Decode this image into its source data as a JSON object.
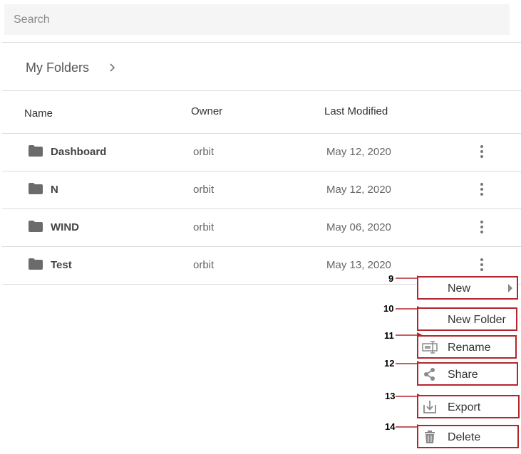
{
  "search": {
    "placeholder": "Search",
    "value": ""
  },
  "breadcrumb": {
    "label": "My Folders"
  },
  "table": {
    "headers": {
      "name": "Name",
      "owner": "Owner",
      "modified": "Last Modified"
    },
    "rows": [
      {
        "name": "Dashboard",
        "owner": "orbit",
        "modified": "May 12, 2020"
      },
      {
        "name": "N",
        "owner": "orbit",
        "modified": "May 12, 2020"
      },
      {
        "name": "WIND",
        "owner": "orbit",
        "modified": "May 06, 2020"
      },
      {
        "name": "Test",
        "owner": "orbit",
        "modified": "May 13, 2020"
      }
    ]
  },
  "context_menu": {
    "items": [
      {
        "label": "New",
        "callout": "9",
        "icon": "",
        "submenu": true
      },
      {
        "label": "New Folder",
        "callout": "10",
        "icon": ""
      },
      {
        "label": "Rename",
        "callout": "11",
        "icon": "rename-icon"
      },
      {
        "label": "Share",
        "callout": "12",
        "icon": "share-icon"
      },
      {
        "label": "Export",
        "callout": "13",
        "icon": "export-icon"
      },
      {
        "label": "Delete",
        "callout": "14",
        "icon": "trash-icon"
      }
    ]
  },
  "colors": {
    "highlight": "#b3262c",
    "icon": "#6b6b6b",
    "search_bg": "#f5f5f5"
  }
}
